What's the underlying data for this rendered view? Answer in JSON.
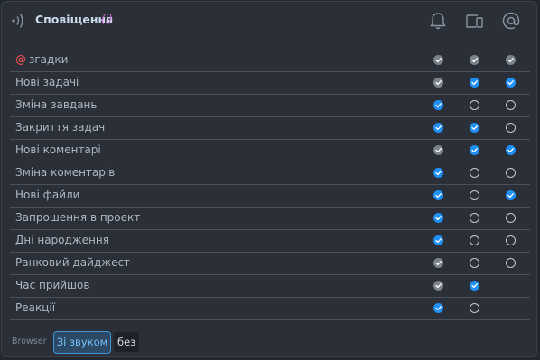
{
  "header": {
    "title": "Сповіщення",
    "info": "(i)",
    "icons": [
      "sound-waves-icon",
      "bell-icon",
      "devices-icon",
      "at-icon"
    ]
  },
  "columns": [
    "bell",
    "devices",
    "at"
  ],
  "rows": [
    {
      "label": "згадки",
      "prefix": "@",
      "marks": [
        "dim",
        "dim",
        "dim"
      ]
    },
    {
      "label": "Нові задачі",
      "marks": [
        "dim",
        "on",
        "on"
      ]
    },
    {
      "label": "Зміна завдань",
      "marks": [
        "on",
        "off",
        "off"
      ]
    },
    {
      "label": "Закриття задач",
      "marks": [
        "on",
        "on",
        "off"
      ]
    },
    {
      "label": "Нові коментарі",
      "marks": [
        "dim",
        "on",
        "on"
      ]
    },
    {
      "label": "Зміна коментарів",
      "marks": [
        "on",
        "off",
        "off"
      ]
    },
    {
      "label": "Нові файли",
      "marks": [
        "on",
        "off",
        "on"
      ]
    },
    {
      "label": "Запрошення в проект",
      "marks": [
        "on",
        "off",
        "off"
      ]
    },
    {
      "label": "Дні народження",
      "marks": [
        "on",
        "off",
        "off"
      ]
    },
    {
      "label": "Ранковий дайджест",
      "marks": [
        "dim",
        "off",
        "off"
      ]
    },
    {
      "label": "Час прийшов",
      "marks": [
        "dim",
        "on",
        "none"
      ]
    },
    {
      "label": "Реакції",
      "marks": [
        "on",
        "off",
        "none"
      ]
    }
  ],
  "footer": {
    "browser_label": "Browser",
    "sound_on": "Зі звуком",
    "sound_off": "без"
  },
  "colors": {
    "background": "#232830",
    "panel": "#2a2f38",
    "accent": "#1e90ff",
    "mention": "#e05050",
    "info": "#d06bd8"
  }
}
